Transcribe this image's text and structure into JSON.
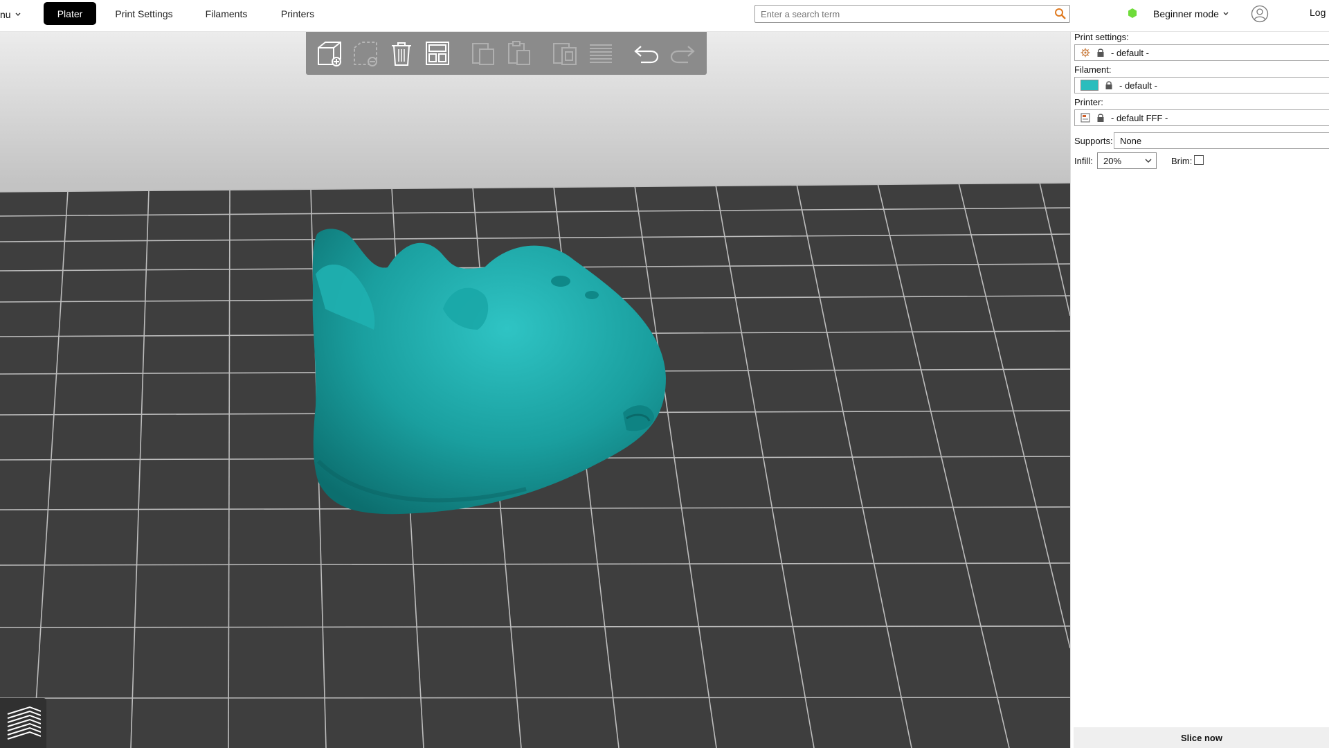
{
  "topbar": {
    "menu_label": "nu",
    "tabs": [
      {
        "label": "Plater",
        "active": true
      },
      {
        "label": "Print Settings",
        "active": false
      },
      {
        "label": "Filaments",
        "active": false
      },
      {
        "label": "Printers",
        "active": false
      }
    ],
    "search_placeholder": "Enter a search term",
    "mode_label": "Beginner mode",
    "mode_color": "#6fdc3a",
    "login_label": "Log i"
  },
  "toolbar": {
    "icons": [
      "add-icon",
      "delete-icon",
      "delete-all-icon",
      "arrange-icon",
      "copy-icon",
      "paste-icon",
      "instances-icon",
      "split-icon",
      "undo-icon",
      "redo-icon"
    ]
  },
  "sidebar": {
    "print_settings_label": "Print settings:",
    "print_settings_value": "- default -",
    "filament_label": "Filament:",
    "filament_value": "- default -",
    "filament_color": "#2bbdbd",
    "printer_label": "Printer:",
    "printer_value": "- default FFF -",
    "supports_label": "Supports:",
    "supports_value": "None",
    "infill_label": "Infill:",
    "infill_value": "20%",
    "brim_label": "Brim:",
    "brim_checked": false,
    "slice_label": "Slice now"
  },
  "model": {
    "color": "#1a9a9a"
  }
}
